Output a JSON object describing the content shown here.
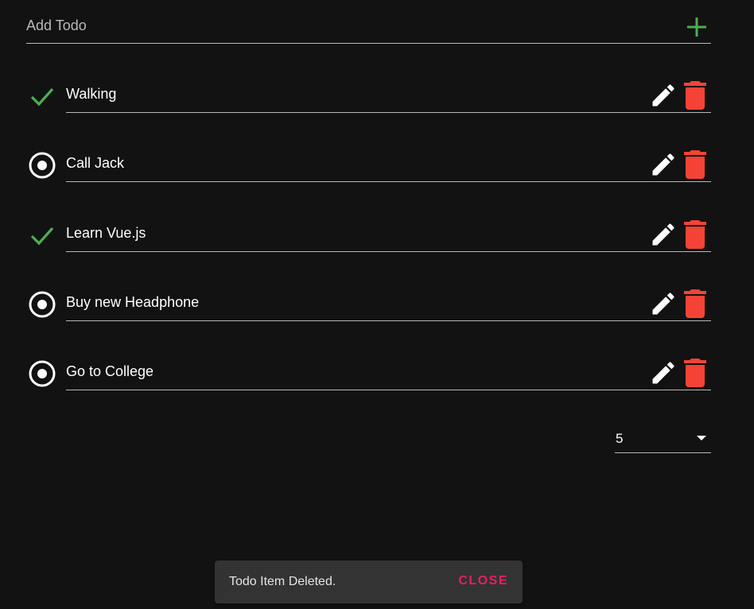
{
  "add_todo": {
    "placeholder": "Add Todo",
    "add_icon": "plus-icon",
    "accent_color": "#4caf50"
  },
  "todos": [
    {
      "text": "Walking",
      "done": true,
      "status_icon": "checkmark-icon"
    },
    {
      "text": "Call Jack",
      "done": false,
      "status_icon": "radio-circle-icon"
    },
    {
      "text": "Learn Vue.js",
      "done": true,
      "status_icon": "checkmark-icon"
    },
    {
      "text": "Buy new Headphone",
      "done": false,
      "status_icon": "radio-circle-icon"
    },
    {
      "text": "Go to College",
      "done": false,
      "status_icon": "radio-circle-icon"
    }
  ],
  "actions": {
    "edit_icon": "pencil-icon",
    "delete_icon": "trash-icon",
    "delete_color": "#f44336"
  },
  "per_page": {
    "selected": "5"
  },
  "snackbar": {
    "message": "Todo Item Deleted.",
    "close_label": "CLOSE",
    "close_color": "#e91e63"
  }
}
